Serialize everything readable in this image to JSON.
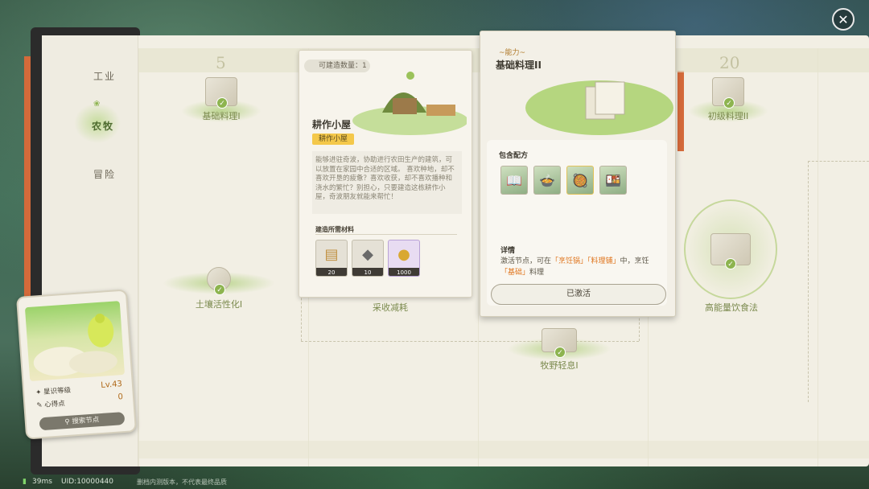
{
  "window": {
    "close_icon": "✕"
  },
  "sidebar": {
    "tabs": [
      {
        "label": "工业",
        "active": false
      },
      {
        "label": "农牧",
        "active": true
      },
      {
        "label": "冒险",
        "active": false
      }
    ]
  },
  "columns": {
    "numbers": [
      "5",
      "20"
    ]
  },
  "nodes": [
    {
      "label": "基础料理I",
      "completed": true
    },
    {
      "label": "初级料理II",
      "completed": true
    },
    {
      "label": "土壤活性化I",
      "completed": true
    },
    {
      "label": "采收减耗",
      "completed": false
    },
    {
      "label": "牧野轻息I",
      "completed": true
    },
    {
      "label": "高能量饮食法",
      "completed": true
    }
  ],
  "building_card": {
    "count_label": "可建造数量：1",
    "title": "耕作小屋",
    "tag": "耕作小屋",
    "description": "能够进驻奇波，协助进行农田生产的建筑，可以放置在家园中合适的区域。\n喜欢种地，却不喜欢开垦的疲惫？喜欢收获，却不喜欢播种和浇水的繁忙？别担心，只要建造这栋耕作小屋，奇波朋友就能来帮忙！",
    "materials_title": "建造所需材料",
    "materials": [
      {
        "name": "wood-plank",
        "icon": "▤",
        "qty": "20"
      },
      {
        "name": "stone",
        "icon": "◆",
        "qty": "10"
      },
      {
        "name": "gold-coin",
        "icon": "●",
        "qty": "1000"
      }
    ]
  },
  "ability_card": {
    "kind": "~能力~",
    "title": "基础料理II",
    "recipes_title": "包含配方",
    "recipes": [
      {
        "name": "recipe-book",
        "icon": "📖"
      },
      {
        "name": "recipe-bowl",
        "icon": "🍲"
      },
      {
        "name": "recipe-stew",
        "icon": "🥘"
      },
      {
        "name": "recipe-plate",
        "icon": "🍱"
      }
    ],
    "detail_title": "详情",
    "detail_prefix": "激活节点，可在",
    "detail_hl1": "「烹饪锅」「料理铺」",
    "detail_mid": "中，烹饪",
    "detail_hl2": "「基础」",
    "detail_suffix": "料理",
    "button_label": "已激活"
  },
  "player_card": {
    "level_label": "星识等级",
    "level_value": "Lv.43",
    "points_label": "心得点",
    "points_value": "0",
    "search_label": "搜索节点"
  },
  "status_bar": {
    "ping": "39ms",
    "uid": "UID:10000440",
    "notice": "删档内测版本，不代表最终品质"
  },
  "colors": {
    "accent_green": "#8db44f",
    "accent_orange": "#e0761f",
    "tag_yellow": "#f4c84a",
    "ribbon": "#d46a3a"
  }
}
